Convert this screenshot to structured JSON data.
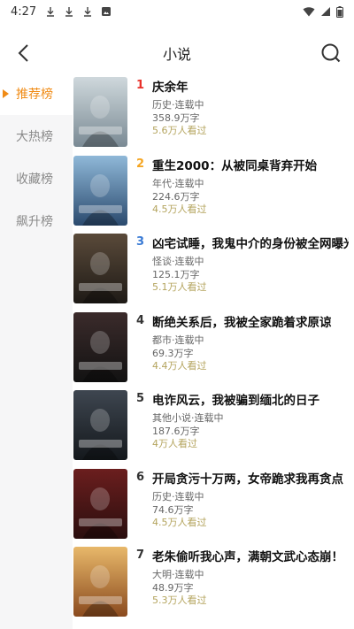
{
  "status_bar": {
    "time": "4:27"
  },
  "header": {
    "title": "小说"
  },
  "sidebar": {
    "items": [
      {
        "label": "推荐榜",
        "active": true
      },
      {
        "label": "大热榜",
        "active": false
      },
      {
        "label": "收藏榜",
        "active": false
      },
      {
        "label": "飙升榜",
        "active": false
      }
    ]
  },
  "books": [
    {
      "rank": "1",
      "title": "庆余年",
      "genre": "历史·连载中",
      "words": "358.9万字",
      "readers": "5.6万人看过",
      "cover_colors": [
        "#cfd8dc",
        "#7a8a94"
      ]
    },
    {
      "rank": "2",
      "title": "重生2000：从被同桌背弃开始",
      "genre": "年代·连载中",
      "words": "224.6万字",
      "readers": "4.5万人看过",
      "cover_colors": [
        "#8fb8d8",
        "#2b4a6e"
      ]
    },
    {
      "rank": "3",
      "title": "凶宅试睡，我鬼中介的身份被全网曝光",
      "genre": "怪谈·连载中",
      "words": "125.1万字",
      "readers": "5.1万人看过",
      "cover_colors": [
        "#5a4a3a",
        "#1e1a16"
      ]
    },
    {
      "rank": "4",
      "title": "断绝关系后，我被全家跪着求原谅",
      "genre": "都市·连载中",
      "words": "69.3万字",
      "readers": "4.4万人看过",
      "cover_colors": [
        "#3b2b2b",
        "#121212"
      ]
    },
    {
      "rank": "5",
      "title": "电诈风云，我被骗到缅北的日子",
      "genre": "其他小说·连载中",
      "words": "187.6万字",
      "readers": "4万人看过",
      "cover_colors": [
        "#3e4650",
        "#14181c"
      ]
    },
    {
      "rank": "6",
      "title": "开局贪污十万两，女帝跪求我再贪点",
      "genre": "历史·连载中",
      "words": "74.6万字",
      "readers": "4.5万人看过",
      "cover_colors": [
        "#6b1e1e",
        "#2a0e0e"
      ]
    },
    {
      "rank": "7",
      "title": "老朱偷听我心声，满朝文武心态崩！",
      "genre": "大明·连载中",
      "words": "48.9万字",
      "readers": "5.3万人看过",
      "cover_colors": [
        "#e8b86a",
        "#8a4a1e"
      ]
    }
  ]
}
